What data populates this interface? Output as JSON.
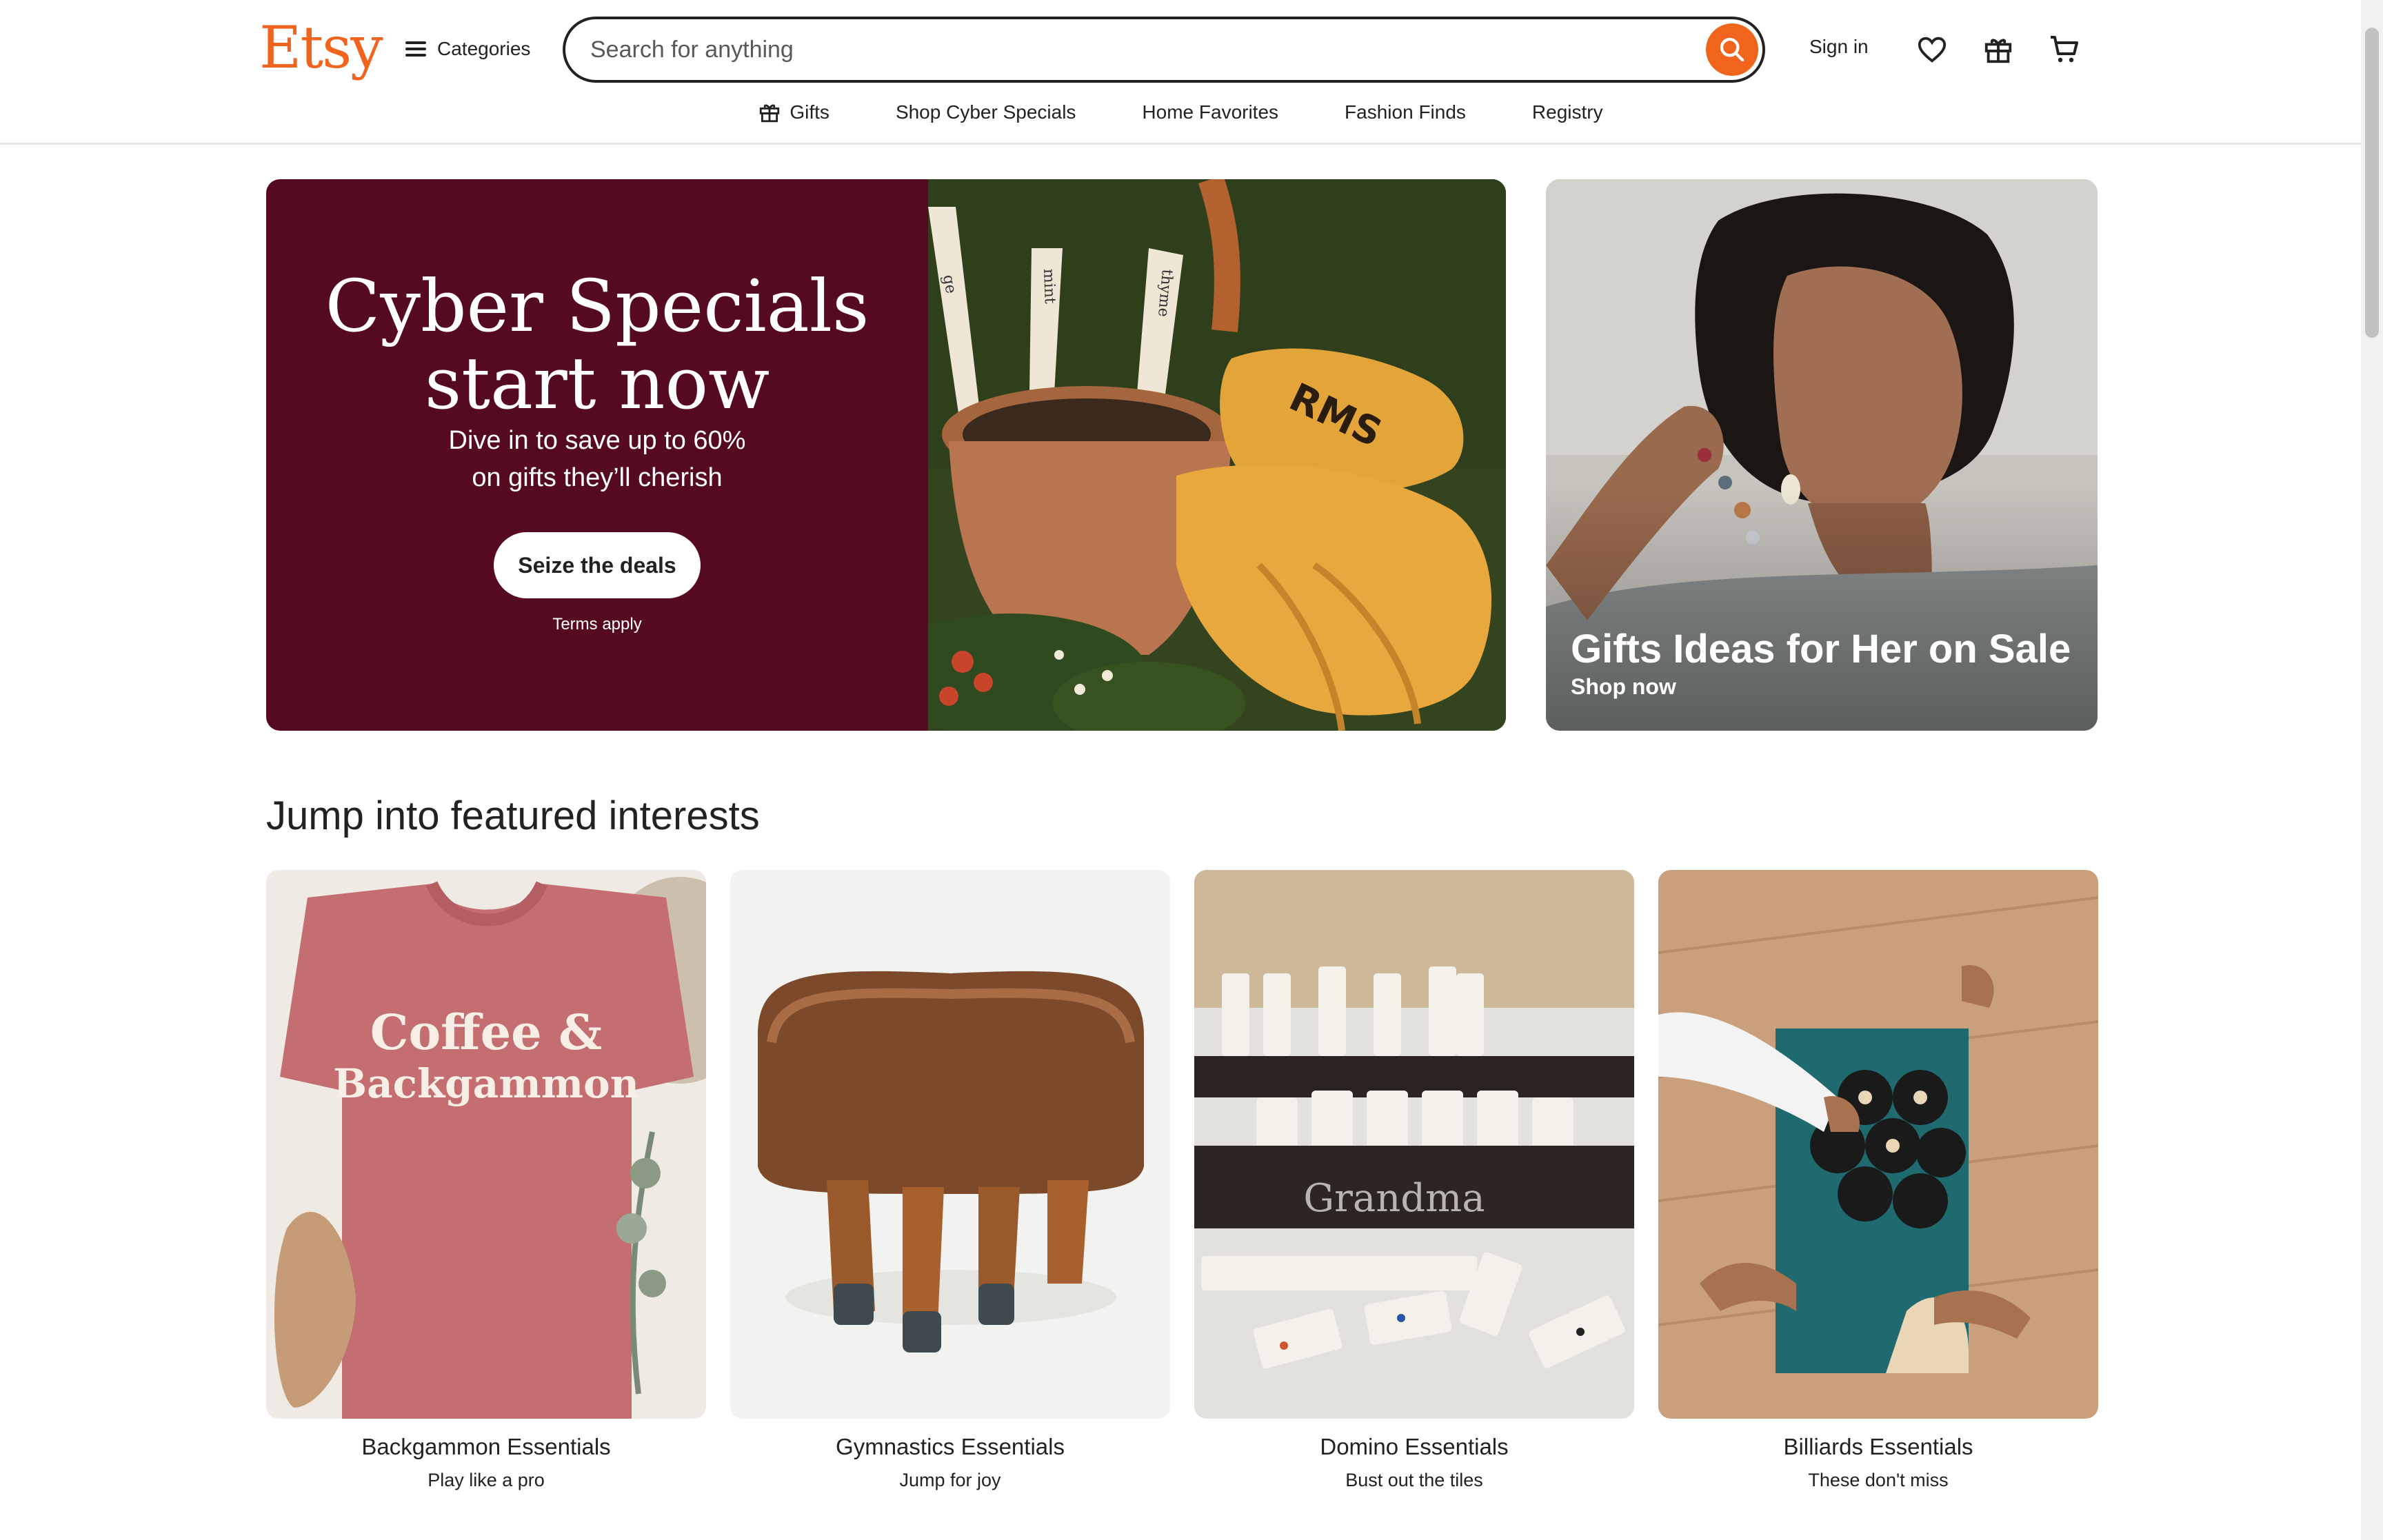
{
  "header": {
    "logo": "Etsy",
    "categories_label": "Categories",
    "search_placeholder": "Search for anything",
    "signin_label": "Sign in",
    "icons": [
      "search-icon",
      "heart-icon",
      "gift-icon",
      "cart-icon",
      "menu-icon"
    ]
  },
  "subnav": {
    "items": [
      "Gifts",
      "Shop Cyber Specials",
      "Home Favorites",
      "Fashion Finds",
      "Registry"
    ]
  },
  "hero": {
    "title_line1": "Cyber Specials",
    "title_line2": "start now",
    "subtitle_line1": "Dive in to save up to 60%",
    "subtitle_line2": "on gifts they’ll cherish",
    "button_label": "Seize the deals",
    "terms": "Terms apply",
    "background_color": "#560a20",
    "plant_marker_labels": [
      "ge",
      "mint",
      "thyme"
    ],
    "glove_monogram": "RMS"
  },
  "promo_her": {
    "title": "Gifts Ideas for Her on Sale",
    "link": "Shop now"
  },
  "featured": {
    "title": "Jump into featured interests",
    "cards": [
      {
        "title": "Backgammon Essentials",
        "subtitle": "Play like a pro",
        "shirt_text_line1": "Coffee &",
        "shirt_text_line2": "Backgammon"
      },
      {
        "title": "Gymnastics Essentials",
        "subtitle": "Jump for joy"
      },
      {
        "title": "Domino Essentials",
        "subtitle": "Bust out the tiles",
        "rack_text": "Grandma"
      },
      {
        "title": "Billiards Essentials",
        "subtitle": "These don't miss"
      }
    ]
  },
  "colors": {
    "brand_orange": "#f1641e",
    "text": "#222222"
  }
}
